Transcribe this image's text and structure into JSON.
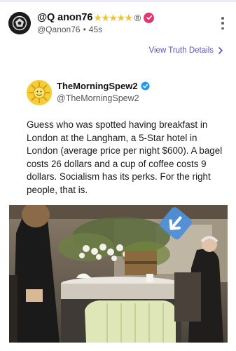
{
  "post": {
    "display_name": "@Q anon76",
    "stars": "★★★★★",
    "reg_mark": "®",
    "handle": "@Qanon76",
    "separator": "•",
    "time_ago": "45s",
    "view_details_label": "View Truth Details"
  },
  "quoted": {
    "display_name": "TheMorningSpew2",
    "handle": "@TheMorningSpew2",
    "text": "Guess who was spotted having breakfast in London at the Langham, a 5-Star hotel in London (average price per night $600). A bagel costs 26 dollars and a cup of coffee costs 9 dollars. Socialism has its perks. For the right people, that is."
  },
  "colors": {
    "accent": "#5a4fcf",
    "verified_badge": "#e3366f",
    "quoted_verified": "#1d9bf0",
    "stars": "#f1c232"
  },
  "icons": {
    "avatar": "dark-emblem-avatar",
    "verified": "checkmark-badge-icon",
    "more": "vertical-ellipsis-icon",
    "chevron": "chevron-right-icon",
    "quoted_avatar": "sunburst-avatar"
  }
}
